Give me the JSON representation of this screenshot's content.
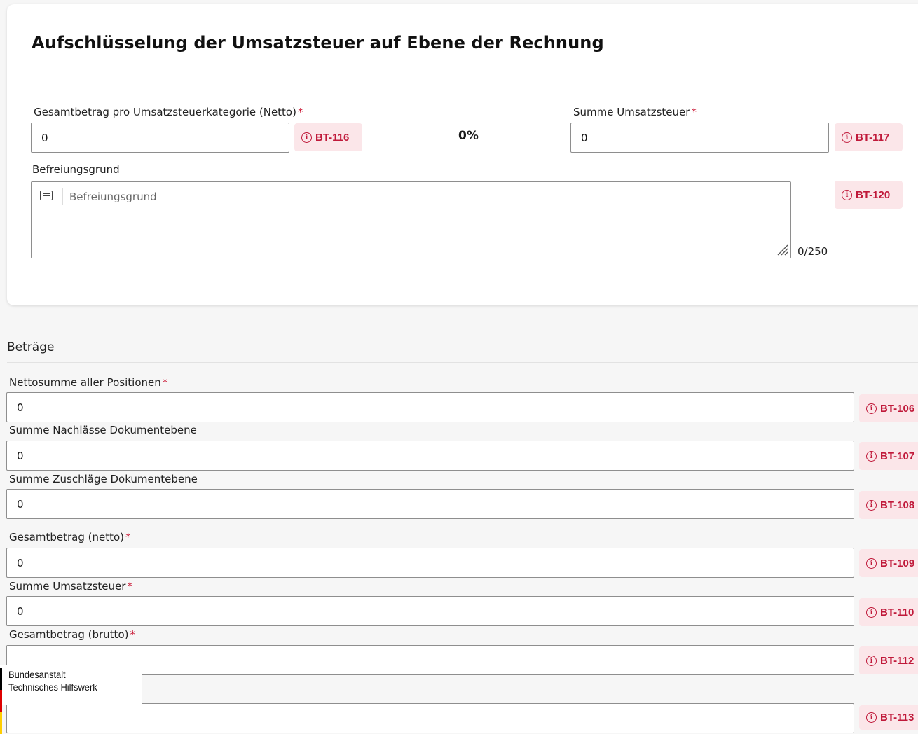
{
  "vat_breakdown": {
    "title": "Aufschlüsselung der Umsatzsteuer auf Ebene der Rechnung",
    "net_amount": {
      "label": "Gesamtbetrag pro Umsatzsteuerkategorie (Netto)",
      "required_mark": "*",
      "value": "0",
      "badge": "BT-116"
    },
    "percent": "0%",
    "vat_sum": {
      "label": "Summe Umsatzsteuer",
      "required_mark": "*",
      "value": "0",
      "badge": "BT-117"
    },
    "exemption": {
      "label": "Befreiungsgrund",
      "placeholder": "Befreiungsgrund",
      "badge": "BT-120",
      "counter": "0/250"
    }
  },
  "amounts": {
    "title": "Beträge",
    "fields": [
      {
        "label": "Nettosumme aller Positionen",
        "required_mark": "*",
        "value": "0",
        "badge": "BT-106"
      },
      {
        "label": "Summe Nachlässe Dokumentebene",
        "required_mark": "",
        "value": "0",
        "badge": "BT-107"
      },
      {
        "label": "Summe Zuschläge Dokumentebene",
        "required_mark": "",
        "value": "0",
        "badge": "BT-108"
      },
      {
        "label": "Gesamtbetrag (netto)",
        "required_mark": "*",
        "value": "0",
        "badge": "BT-109"
      },
      {
        "label": "Summe Umsatzsteuer",
        "required_mark": "*",
        "value": "0",
        "badge": "BT-110"
      },
      {
        "label": "Gesamtbetrag (brutto)",
        "required_mark": "*",
        "value": "",
        "badge": "BT-112"
      },
      {
        "label": "",
        "required_mark": "",
        "value": "",
        "badge": "BT-113"
      }
    ]
  },
  "logo": {
    "line1": "Bundesanstalt",
    "line2": "Technisches Hilfswerk"
  },
  "icons": {
    "info": "info-circle-icon",
    "text": "text-lines-icon",
    "resize": "resize-handle-icon"
  },
  "colors": {
    "badge_bg": "#fbe6e9",
    "badge_fg": "#c0193a",
    "required": "#c8102e"
  }
}
